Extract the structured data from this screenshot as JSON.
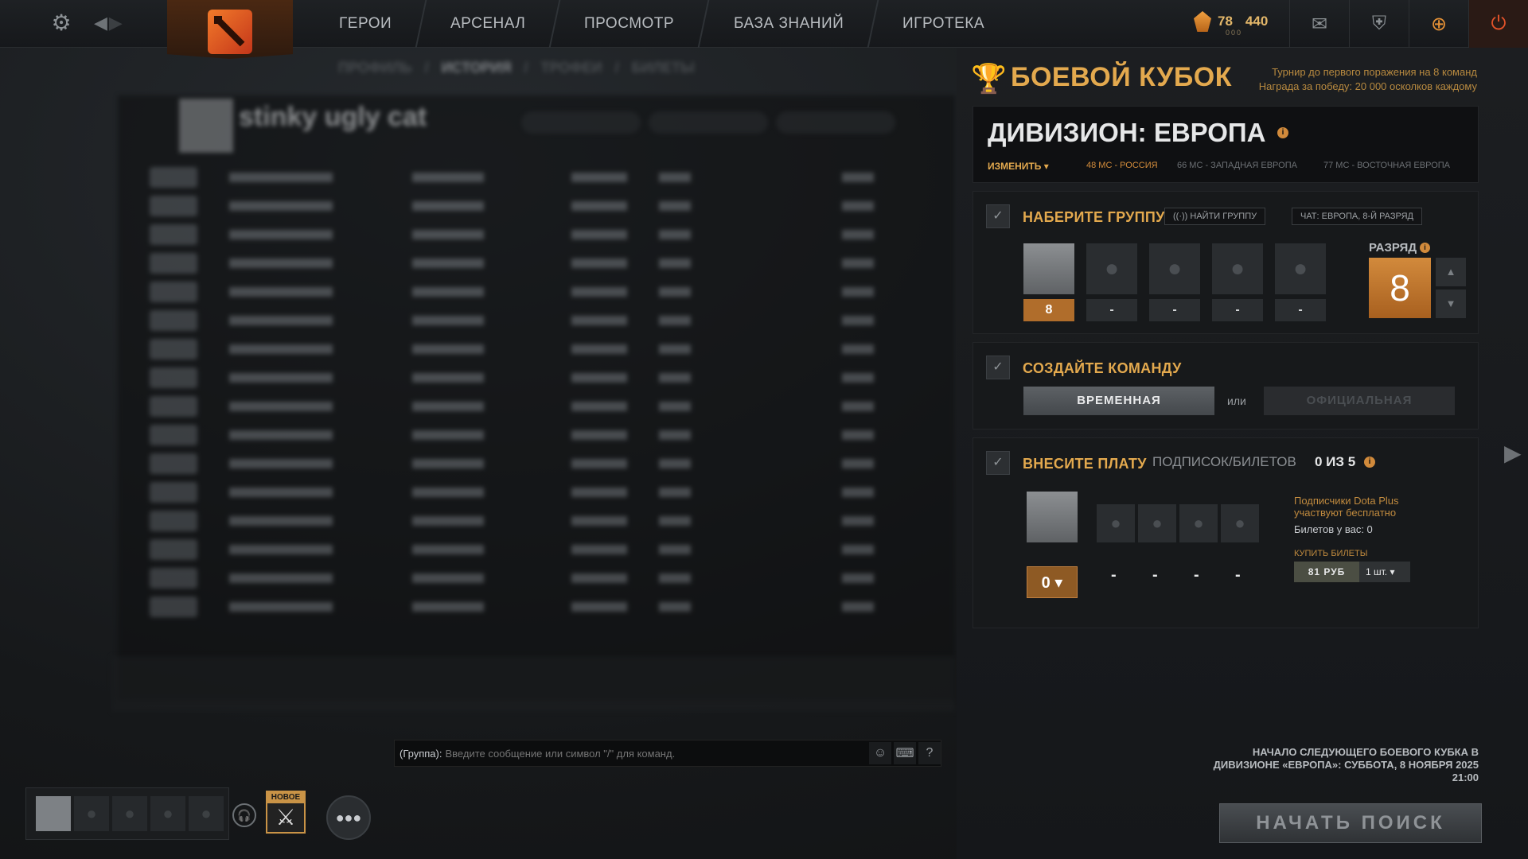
{
  "topbar": {
    "nav": [
      "ГЕРОИ",
      "АРСЕНАЛ",
      "ПРОСМОТР",
      "БАЗА ЗНАНИЙ",
      "ИГРОТЕКА"
    ],
    "shards": "78",
    "gold": "440",
    "shards_sub": "000"
  },
  "background": {
    "breadcrumb": [
      "ПРОФИЛЬ",
      "ИСТОРИЯ",
      "ТРОФЕИ",
      "БИЛЕТЫ"
    ],
    "profile_name": "stinky ugly cat"
  },
  "chat": {
    "channel": "(Группа):",
    "placeholder": "Введите сообщение или символ \"/\" для команд.",
    "help": "?"
  },
  "bottom": {
    "new_tag": "НОВОЕ"
  },
  "battle_cup": {
    "title": "БОЕВОЙ КУБОК",
    "sub1": "Турнир до первого поражения на 8 команд",
    "sub2": "Награда за победу: 20 000 осколков каждому",
    "division": {
      "title": "ДИВИЗИОН: ЕВРОПА",
      "change": "ИЗМЕНИТЬ ▾",
      "mm": [
        "48 МС - РОССИЯ",
        "66 МС - ЗАПАДНАЯ ЕВРОПА",
        "77 МС - ВОСТОЧНАЯ ЕВРОПА"
      ]
    },
    "step1": {
      "title": "НАБЕРИТЕ ГРУППУ",
      "find": "НАЙТИ ГРУППУ",
      "chat": "ЧАТ: ЕВРОПА, 8-Й РАЗРЯД",
      "slots": [
        "8",
        "-",
        "-",
        "-",
        "-"
      ],
      "rank_label": "РАЗРЯД",
      "rank_value": "8"
    },
    "step2": {
      "title": "СОЗДАЙТЕ КОМАНДУ",
      "temp": "ВРЕМЕННАЯ",
      "or": "или",
      "official": "ОФИЦИАЛЬНАЯ"
    },
    "step3": {
      "title": "ВНЕСИТЕ ПЛАТУ",
      "sub": "ПОДПИСОК/БИЛЕТОВ",
      "count": "0 ИЗ 5",
      "my_tickets": "0",
      "dashes": [
        "-",
        "-",
        "-",
        "-"
      ],
      "plus_note": "Подписчики Dota Plus участвуют бесплатно",
      "tickets": "Билетов у вас: 0",
      "buy_label": "КУПИТЬ БИЛЕТЫ",
      "price": "81 РУБ",
      "qty": "1 шт."
    },
    "next": "НАЧАЛО СЛЕДУЮЩЕГО БОЕВОГО КУБКА В ДИВИЗИОНЕ «ЕВРОПА»: СУББОТА, 8 НОЯБРЯ 2025 21:00",
    "search": "НАЧАТЬ ПОИСК"
  }
}
